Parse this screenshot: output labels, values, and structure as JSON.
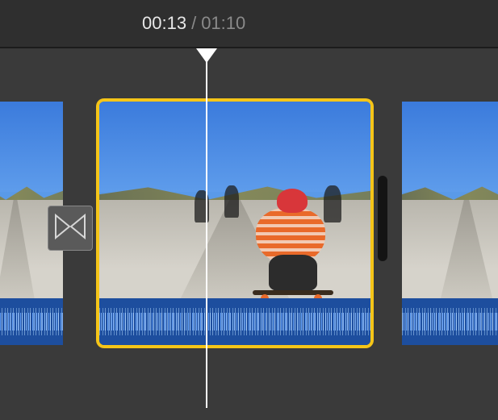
{
  "header": {
    "current_time": "00:13",
    "separator": "/",
    "total_time": "01:10"
  },
  "colors": {
    "selection": "#f5c518",
    "audio_track": "#1d4e9e",
    "playhead": "#ffffff"
  },
  "timeline": {
    "clips": [
      {
        "id": "clip-left",
        "selected": false,
        "scene": "skateboarders-road"
      },
      {
        "id": "clip-center",
        "selected": true,
        "scene": "skateboarders-road"
      },
      {
        "id": "clip-right",
        "selected": false,
        "scene": "skateboarders-road"
      }
    ],
    "transition_icon": "crossfade-icon"
  }
}
